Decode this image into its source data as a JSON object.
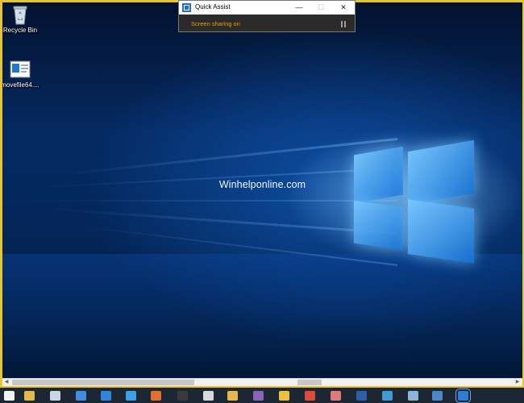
{
  "desktop": {
    "watermark": "Winhelponline.com",
    "icons": [
      {
        "label": "Recycle Bin",
        "icon": "recycle-bin-icon"
      },
      {
        "label": "movefile64....",
        "icon": "file-shortcut-icon"
      }
    ]
  },
  "quick_assist": {
    "title": "Quick Assist",
    "status": "Screen sharing on",
    "status_color": "#e8a000",
    "controls": {
      "minimize": "—",
      "maximize": "☐",
      "close": "✕"
    }
  },
  "taskbar": {
    "icons": [
      {
        "name": "start-icon",
        "color": "#f2f2f2"
      },
      {
        "name": "notepad-icon",
        "color": "#e6b84c"
      },
      {
        "name": "window-icon",
        "color": "#c8d7e6"
      },
      {
        "name": "network-icon",
        "color": "#3d8fe0"
      },
      {
        "name": "edge-icon",
        "color": "#2f86e0"
      },
      {
        "name": "ie-icon",
        "color": "#3aa0e8"
      },
      {
        "name": "firefox-icon",
        "color": "#e3702a"
      },
      {
        "name": "cmd-icon",
        "color": "#3a3a3a"
      },
      {
        "name": "explorer-icon",
        "color": "#d9d9d9"
      },
      {
        "name": "folder-icon",
        "color": "#e7b74a"
      },
      {
        "name": "app-icon",
        "color": "#8a62b8"
      },
      {
        "name": "files-icon",
        "color": "#f0c03c"
      },
      {
        "name": "chrome-icon",
        "color": "#dd4b39"
      },
      {
        "name": "paint-icon",
        "color": "#e07b7b"
      },
      {
        "name": "powershell-icon",
        "color": "#2d5fa8"
      },
      {
        "name": "remote-icon",
        "color": "#3f9ad6"
      },
      {
        "name": "settings-icon",
        "color": "#8ab4d8"
      },
      {
        "name": "store-icon",
        "color": "#4b87c9"
      },
      {
        "name": "quick-assist-icon",
        "color": "#2f7bd6"
      }
    ]
  }
}
